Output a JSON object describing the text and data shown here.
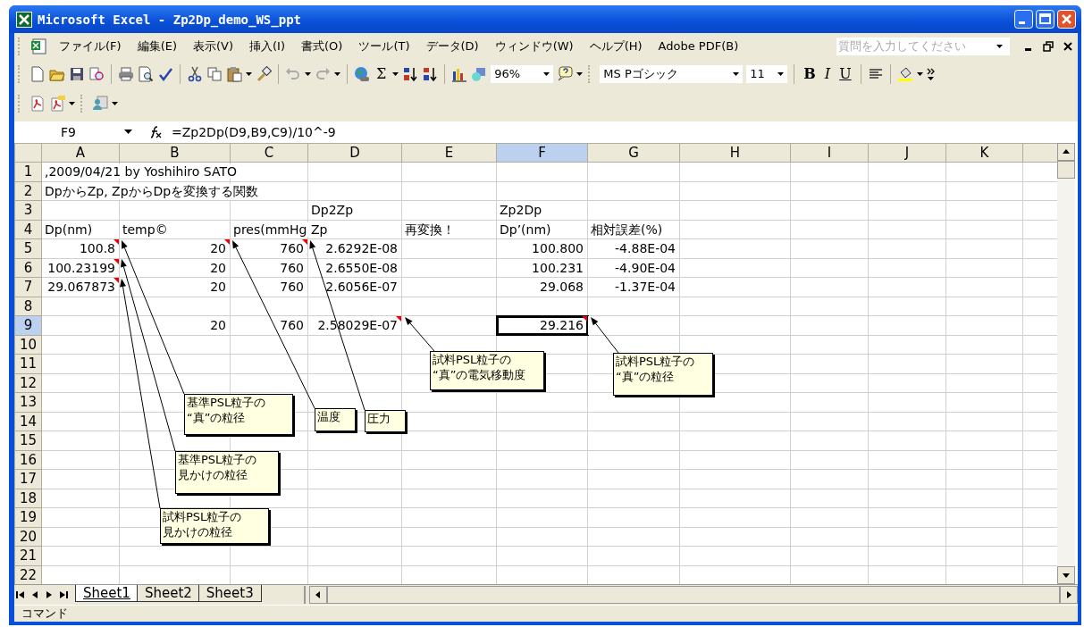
{
  "window": {
    "title": "Microsoft Excel - Zp2Dp_demo_WS_ppt"
  },
  "menu_bar": {
    "items": [
      {
        "label": "ファイル(F)"
      },
      {
        "label": "編集(E)"
      },
      {
        "label": "表示(V)"
      },
      {
        "label": "挿入(I)"
      },
      {
        "label": "書式(O)"
      },
      {
        "label": "ツール(T)"
      },
      {
        "label": "データ(D)"
      },
      {
        "label": "ウィンドウ(W)"
      },
      {
        "label": "ヘルプ(H)"
      },
      {
        "label": "Adobe PDF(B)"
      }
    ],
    "help_search": {
      "placeholder": "質問を入力してください"
    }
  },
  "standard_toolbar": {
    "sum": "Σ",
    "zoom": "96%"
  },
  "formatting_toolbar": {
    "font": "MS Pゴシック",
    "size": "11",
    "bold": "B",
    "italic": "I",
    "underline": "U"
  },
  "formula_bar": {
    "name_box": "F9",
    "formula": "=Zp2Dp(D9,B9,C9)/10^-9"
  },
  "columns": [
    {
      "label": "A",
      "selected": false
    },
    {
      "label": "B",
      "selected": false
    },
    {
      "label": "C",
      "selected": false
    },
    {
      "label": "D",
      "selected": false
    },
    {
      "label": "E",
      "selected": false
    },
    {
      "label": "F",
      "selected": true
    },
    {
      "label": "G",
      "selected": false
    },
    {
      "label": "H",
      "selected": false
    },
    {
      "label": "I",
      "selected": false
    },
    {
      "label": "J",
      "selected": false
    },
    {
      "label": "K",
      "selected": false
    }
  ],
  "rows": [
    {
      "number": "1",
      "selected": false,
      "cells": [
        {
          "kind": "text",
          "text": ",2009/04/21  by Yoshihiro SATO",
          "comment": false
        }
      ]
    },
    {
      "number": "2",
      "selected": false,
      "cells": [
        {
          "kind": "text",
          "text": "DpからZp, ZpからDpを変換する関数",
          "comment": false
        }
      ]
    },
    {
      "number": "3",
      "selected": false,
      "cells": [
        {
          "kind": "blank"
        },
        {
          "kind": "blank"
        },
        {
          "kind": "blank"
        },
        {
          "kind": "text",
          "text": "Dp2Zp",
          "comment": false
        },
        {
          "kind": "blank"
        },
        {
          "kind": "text",
          "text": "Zp2Dp",
          "comment": false
        }
      ]
    },
    {
      "number": "4",
      "selected": false,
      "cells": [
        {
          "kind": "text",
          "text": "Dp(nm)",
          "comment": false
        },
        {
          "kind": "text",
          "text": "temp©",
          "comment": false
        },
        {
          "kind": "text",
          "text": "pres(mmHg",
          "comment": false
        },
        {
          "kind": "text",
          "text": "Zp",
          "comment": false
        },
        {
          "kind": "text",
          "text": "再変換！",
          "comment": false
        },
        {
          "kind": "text",
          "text": "Dp’(nm)",
          "comment": false
        },
        {
          "kind": "text",
          "text": "相対誤差(%)",
          "comment": false
        }
      ]
    },
    {
      "number": "5",
      "selected": false,
      "cells": [
        {
          "kind": "number",
          "text": "100.8",
          "comment": true
        },
        {
          "kind": "number",
          "text": "20",
          "comment": true
        },
        {
          "kind": "number",
          "text": "760",
          "comment": true
        },
        {
          "kind": "number",
          "text": "2.6292E-08",
          "comment": false
        },
        {
          "kind": "blank"
        },
        {
          "kind": "number",
          "text": "100.800",
          "comment": false
        },
        {
          "kind": "number",
          "text": "-4.88E-04",
          "comment": false
        }
      ]
    },
    {
      "number": "6",
      "selected": false,
      "cells": [
        {
          "kind": "number",
          "text": "100.23199",
          "comment": true
        },
        {
          "kind": "number",
          "text": "20",
          "comment": false
        },
        {
          "kind": "number",
          "text": "760",
          "comment": false
        },
        {
          "kind": "number",
          "text": "2.6550E-08",
          "comment": false
        },
        {
          "kind": "blank"
        },
        {
          "kind": "number",
          "text": "100.231",
          "comment": false
        },
        {
          "kind": "number",
          "text": "-4.90E-04",
          "comment": false
        }
      ]
    },
    {
      "number": "7",
      "selected": false,
      "cells": [
        {
          "kind": "number",
          "text": "29.067873",
          "comment": true
        },
        {
          "kind": "number",
          "text": "20",
          "comment": false
        },
        {
          "kind": "number",
          "text": "760",
          "comment": false
        },
        {
          "kind": "number",
          "text": "2.6056E-07",
          "comment": false
        },
        {
          "kind": "blank"
        },
        {
          "kind": "number",
          "text": "29.068",
          "comment": false
        },
        {
          "kind": "number",
          "text": "-1.37E-04",
          "comment": false
        }
      ]
    },
    {
      "number": "8",
      "selected": false
    },
    {
      "number": "9",
      "selected": true,
      "cells": [
        {
          "kind": "blank"
        },
        {
          "kind": "number",
          "text": "20",
          "comment": false
        },
        {
          "kind": "number",
          "text": "760",
          "comment": false
        },
        {
          "kind": "number",
          "text": "2.58029E-07",
          "comment": true
        },
        {
          "kind": "blank"
        },
        {
          "kind": "number",
          "text": "29.216",
          "comment": true
        }
      ]
    },
    {
      "number": "10",
      "selected": false
    },
    {
      "number": "11",
      "selected": false
    },
    {
      "number": "12",
      "selected": false
    },
    {
      "number": "13",
      "selected": false
    },
    {
      "number": "14",
      "selected": false
    },
    {
      "number": "15",
      "selected": false
    },
    {
      "number": "16",
      "selected": false
    },
    {
      "number": "17",
      "selected": false
    },
    {
      "number": "18",
      "selected": false
    },
    {
      "number": "19",
      "selected": false
    },
    {
      "number": "20",
      "selected": false
    },
    {
      "number": "21",
      "selected": false
    },
    {
      "number": "22",
      "selected": false
    }
  ],
  "comments": [
    {
      "lines": [
        "基準PSL粒子の",
        "“真”の粒径"
      ]
    },
    {
      "lines": [
        "基準PSL粒子の",
        "見かけの粒径"
      ]
    },
    {
      "lines": [
        "試料PSL粒子の",
        "見かけの粒径"
      ]
    },
    {
      "lines": [
        "温度"
      ]
    },
    {
      "lines": [
        "圧力"
      ]
    },
    {
      "lines": [
        "試料PSL粒子の",
        "“真”の電気移動度"
      ]
    },
    {
      "lines": [
        "試料PSL粒子の",
        "“真”の粒径"
      ]
    }
  ],
  "sheet_tabs": [
    {
      "label": "Sheet1",
      "selected": true
    },
    {
      "label": "Sheet2",
      "selected": false
    },
    {
      "label": "Sheet3",
      "selected": false
    }
  ],
  "status_bar": {
    "text": "コマンド"
  }
}
